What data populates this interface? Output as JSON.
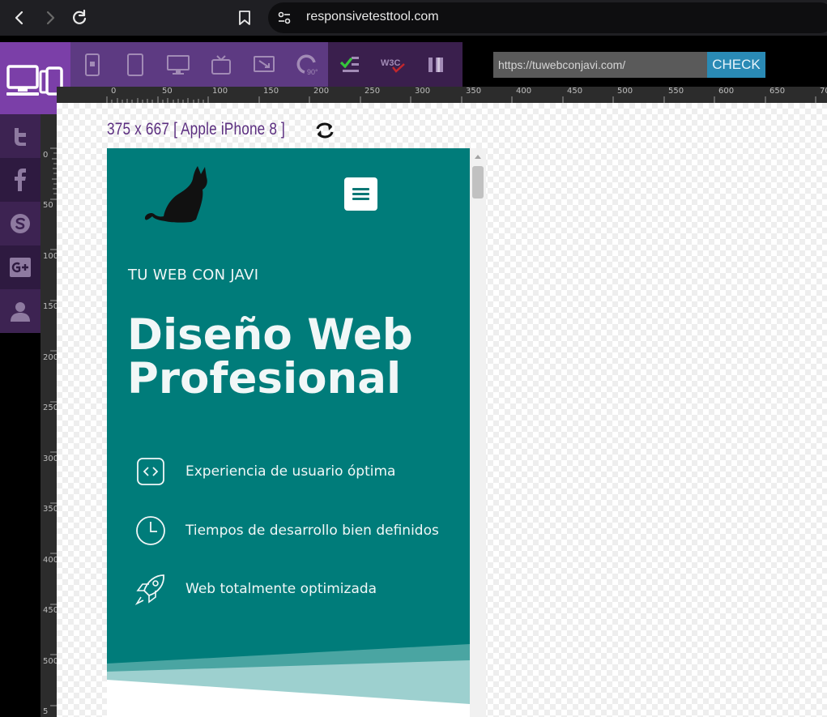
{
  "browser": {
    "url": "responsivetesttool.com"
  },
  "toolbar": {
    "url_input_value": "https://tuwebconjavi.com/",
    "check_label": "CHECK",
    "w3c_label": "W3C",
    "rotate_90_label": "90°"
  },
  "ruler": {
    "h_ticks": [
      "0",
      "50",
      "100",
      "150",
      "200",
      "250",
      "300",
      "350",
      "400",
      "450",
      "500",
      "550",
      "600",
      "650",
      "70"
    ],
    "v_ticks": [
      "0",
      "50",
      "100",
      "150",
      "200",
      "250",
      "300",
      "350",
      "400",
      "450",
      "500",
      "5"
    ]
  },
  "preview": {
    "device_label": "375 x 667 [ Apple iPhone 8 ]"
  },
  "site": {
    "kicker": "TU WEB CON JAVI",
    "headline": "Diseño Web Profesional",
    "features": [
      {
        "icon": "code-icon",
        "text": "Experiencia de usuario óptima"
      },
      {
        "icon": "clock-icon",
        "text": "Tiempos de desarrollo bien definidos"
      },
      {
        "icon": "rocket-icon",
        "text": "Web totalmente optimizada"
      }
    ]
  },
  "colors": {
    "brand_purple": "#7b3fa8",
    "site_teal": "#007c7a",
    "check_blue": "#2a8ab5"
  }
}
